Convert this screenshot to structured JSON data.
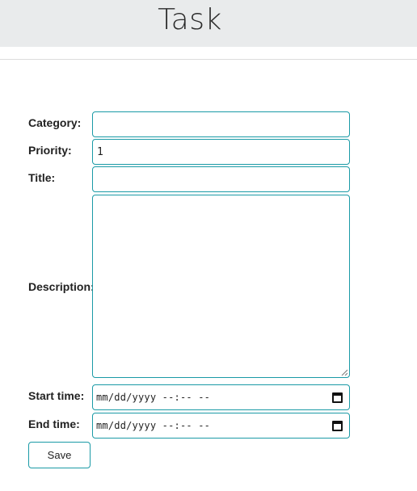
{
  "header": {
    "title": "Task"
  },
  "form": {
    "category": {
      "label": "Category:",
      "value": ""
    },
    "priority": {
      "label": "Priority:",
      "value": "1"
    },
    "title": {
      "label": "Title:",
      "value": ""
    },
    "description": {
      "label": "Description:",
      "value": ""
    },
    "start_time": {
      "label": "Start time:",
      "value": "mm/dd/yyyy --:-- --"
    },
    "end_time": {
      "label": "End time:",
      "value": "mm/dd/yyyy --:-- --"
    },
    "save_label": "Save"
  },
  "colors": {
    "accent_border": "#1a9aa6",
    "header_bg": "#e9ebec"
  },
  "icons": {
    "date_picker": "calendar-icon"
  }
}
